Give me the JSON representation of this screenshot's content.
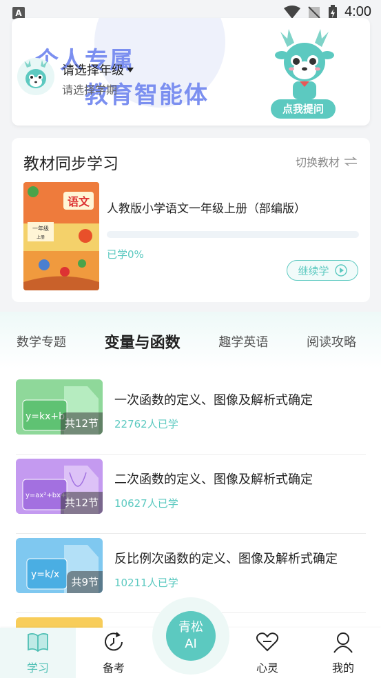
{
  "status_bar": {
    "time": "4:00",
    "left_badge": "A"
  },
  "header": {
    "slogan_line1": "个人专属",
    "slogan_line2": "教育智能体",
    "grade_label": "请选择年级",
    "term_label": "请选择学期",
    "ask_button": "点我提问"
  },
  "textbook": {
    "section_title": "教材同步学习",
    "switch_label": "切换教材",
    "book_title": "人教版小学语文一年级上册（部编版）",
    "progress_label": "已学0%",
    "progress": 0,
    "continue_label": "继续学",
    "cover": {
      "subject": "语文",
      "grade": "一年级",
      "volume": "上册"
    }
  },
  "tabs": [
    {
      "label": "数学专题",
      "active": false
    },
    {
      "label": "变量与函数",
      "active": true
    },
    {
      "label": "趣学英语",
      "active": false
    },
    {
      "label": "阅读攻略",
      "active": false
    }
  ],
  "courses": [
    {
      "title": "一次函数的定义、图像及解析式确定",
      "learners": "22762人已学",
      "lessons": "共12节",
      "formula": "y=kx+b",
      "color": "#8fd89a"
    },
    {
      "title": "二次函数的定义、图像及解析式确定",
      "learners": "10627人已学",
      "lessons": "共12节",
      "formula": "y=ax²+bx+c",
      "color": "#c49af0"
    },
    {
      "title": "反比例次函数的定义、图像及解析式确定",
      "learners": "10211人已学",
      "lessons": "共9节",
      "formula": "y=k/x",
      "color": "#7fc8f0"
    }
  ],
  "bottom_nav": {
    "items": [
      {
        "label": "学习",
        "icon": "book-icon",
        "active": true
      },
      {
        "label": "备考",
        "icon": "refresh-clock-icon",
        "active": false
      },
      {
        "label": "心灵",
        "icon": "heart-icon",
        "active": false
      },
      {
        "label": "我的",
        "icon": "person-icon",
        "active": false
      }
    ],
    "ai_button": {
      "line1": "青松",
      "line2": "AI"
    }
  },
  "colors": {
    "accent": "#5cc9c0",
    "slogan": "#7b8ff0"
  }
}
